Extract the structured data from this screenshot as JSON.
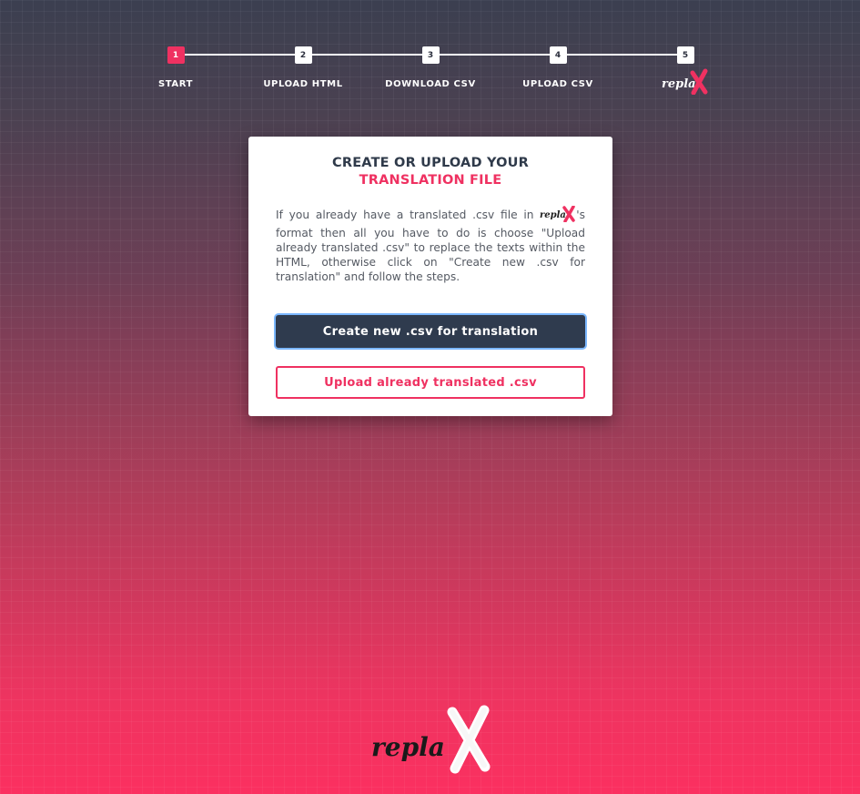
{
  "colors": {
    "accent": "#ef3161",
    "dark": "#2f3b4e",
    "focus_ring": "#7bb7ff"
  },
  "stepper": {
    "steps": [
      {
        "number": "1",
        "label": "START",
        "active": true
      },
      {
        "number": "2",
        "label": "UPLOAD HTML",
        "active": false
      },
      {
        "number": "3",
        "label": "DOWNLOAD CSV",
        "active": false
      },
      {
        "number": "4",
        "label": "UPLOAD CSV",
        "active": false
      },
      {
        "number": "5",
        "label": "",
        "logo": "replax-logo",
        "active": false
      }
    ]
  },
  "card": {
    "title_line1": "CREATE OR UPLOAD YOUR",
    "title_line2": "TRANSLATION FILE",
    "text_before_logo": "If you already have a translated .csv file in ",
    "text_after_logo": "'s format then all you have to do is choose \"Upload already translated .csv\" to replace the texts within the HTML, otherwise click on \"Create new .csv for translation\" and follow the steps.",
    "primary_button": "Create new .csv for translation",
    "secondary_button": "Upload already translated .csv"
  },
  "brand": {
    "logo_text": "repla",
    "logo_mark": "X"
  }
}
